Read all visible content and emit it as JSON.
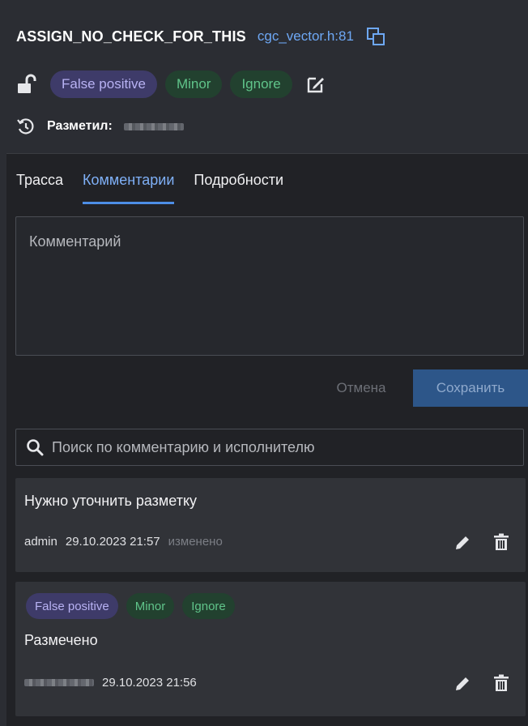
{
  "header": {
    "title": "ASSIGN_NO_CHECK_FOR_THIS",
    "file": "cgc_vector.h:81",
    "badges": [
      "False positive",
      "Minor",
      "Ignore"
    ],
    "author_label": "Разметил:"
  },
  "tabs": [
    {
      "label": "Трасса",
      "active": false
    },
    {
      "label": "Комментарии",
      "active": true
    },
    {
      "label": "Подробности",
      "active": false
    }
  ],
  "comment_form": {
    "placeholder": "Комментарий",
    "cancel_label": "Отмена",
    "save_label": "Сохранить"
  },
  "search": {
    "placeholder": "Поиск по комментарию и исполнителю"
  },
  "comments": [
    {
      "text": "Нужно уточнить разметку",
      "user": "admin",
      "date": "29.10.2023 21:57",
      "changed": "изменено"
    },
    {
      "badges": [
        "False positive",
        "Minor",
        "Ignore"
      ],
      "text": "Размечено",
      "date": "29.10.2023 21:56"
    }
  ],
  "colors": {
    "accent": "#4d8ee6",
    "link": "#6ea8f5",
    "false_positive": "#3e3b69",
    "minor": "#22412f"
  }
}
